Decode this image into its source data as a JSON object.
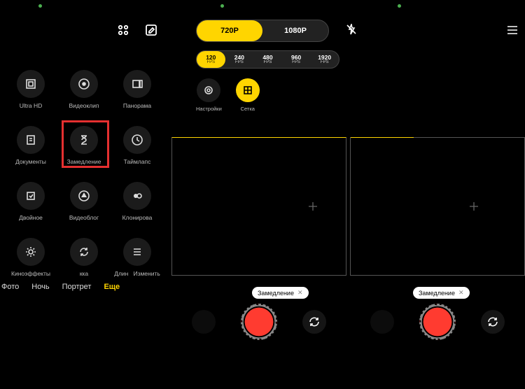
{
  "modes": [
    {
      "id": "ultrahd",
      "label": "Ultra HD"
    },
    {
      "id": "videoclip",
      "label": "Видеоклип"
    },
    {
      "id": "panorama",
      "label": "Панорама"
    },
    {
      "id": "documents",
      "label": "Документы"
    },
    {
      "id": "slowmo",
      "label": "Замедление"
    },
    {
      "id": "timelapse",
      "label": "Таймлапс"
    },
    {
      "id": "dual",
      "label": "Двойное"
    },
    {
      "id": "vlog",
      "label": "Видеоблог"
    },
    {
      "id": "clone",
      "label": "Клонирова"
    },
    {
      "id": "cinema",
      "label": "Киноэффекты"
    },
    {
      "id": "retouch",
      "label": "кка"
    },
    {
      "id": "long",
      "label": "Длин"
    },
    {
      "id": "edit",
      "label": "Изменить"
    }
  ],
  "tabs": {
    "t0": "Фото",
    "t1": "Ночь",
    "t2": "Портрет",
    "t3": "Еще"
  },
  "resolution": {
    "r0": "720P",
    "r1": "1080P"
  },
  "fps": [
    {
      "n": "120",
      "u": "FPS"
    },
    {
      "n": "240",
      "u": "FPS"
    },
    {
      "n": "480",
      "u": "FPS"
    },
    {
      "n": "960",
      "u": "FPS"
    },
    {
      "n": "1920",
      "u": "FPS"
    }
  ],
  "controls": {
    "settings": "Настройки",
    "grid": "Сетка"
  },
  "tag": "Замедление",
  "highlight_mode": "slowmo"
}
